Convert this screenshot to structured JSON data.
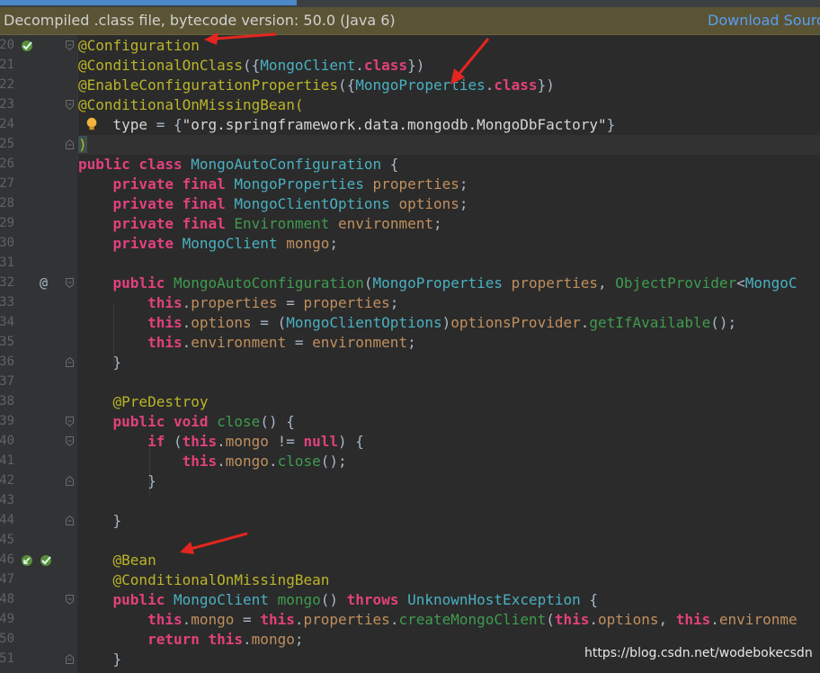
{
  "banner": {
    "message": "Decompiled .class file, bytecode version: 50.0 (Java 6)",
    "download_link": "Download Sourc"
  },
  "watermark": "https://blog.csdn.net/wodebokecsdn",
  "colors": {
    "annotation": "#bbb529",
    "keyword": "#cc7832",
    "arrow": "#e5251f"
  },
  "lines": [
    {
      "num": "20",
      "text": "@Configuration"
    },
    {
      "num": "21",
      "text": "@ConditionalOnClass({MongoClient.class})"
    },
    {
      "num": "22",
      "text": "@EnableConfigurationProperties({MongoProperties.class})"
    },
    {
      "num": "23",
      "text": "@ConditionalOnMissingBean("
    },
    {
      "num": "24",
      "text": "    type = {\"org.springframework.data.mongodb.MongoDbFactory\"}"
    },
    {
      "num": "25",
      "text": ")"
    },
    {
      "num": "26",
      "text": "public class MongoAutoConfiguration {"
    },
    {
      "num": "27",
      "text": "    private final MongoProperties properties;"
    },
    {
      "num": "28",
      "text": "    private final MongoClientOptions options;"
    },
    {
      "num": "29",
      "text": "    private final Environment environment;"
    },
    {
      "num": "30",
      "text": "    private MongoClient mongo;"
    },
    {
      "num": "31",
      "text": ""
    },
    {
      "num": "32",
      "text": "    public MongoAutoConfiguration(MongoProperties properties, ObjectProvider<MongoC"
    },
    {
      "num": "33",
      "text": "        this.properties = properties;"
    },
    {
      "num": "34",
      "text": "        this.options = (MongoClientOptions)optionsProvider.getIfAvailable();"
    },
    {
      "num": "35",
      "text": "        this.environment = environment;"
    },
    {
      "num": "36",
      "text": "    }"
    },
    {
      "num": "37",
      "text": ""
    },
    {
      "num": "38",
      "text": "    @PreDestroy"
    },
    {
      "num": "39",
      "text": "    public void close() {"
    },
    {
      "num": "40",
      "text": "        if (this.mongo != null) {"
    },
    {
      "num": "41",
      "text": "            this.mongo.close();"
    },
    {
      "num": "42",
      "text": "        }"
    },
    {
      "num": "43",
      "text": ""
    },
    {
      "num": "44",
      "text": "    }"
    },
    {
      "num": "45",
      "text": ""
    },
    {
      "num": "46",
      "text": "    @Bean"
    },
    {
      "num": "47",
      "text": "    @ConditionalOnMissingBean"
    },
    {
      "num": "48",
      "text": "    public MongoClient mongo() throws UnknownHostException {"
    },
    {
      "num": "49",
      "text": "        this.mongo = this.properties.createMongoClient(this.options, this.environme"
    },
    {
      "num": "50",
      "text": "        return this.mongo;"
    },
    {
      "num": "51",
      "text": "    }"
    }
  ]
}
